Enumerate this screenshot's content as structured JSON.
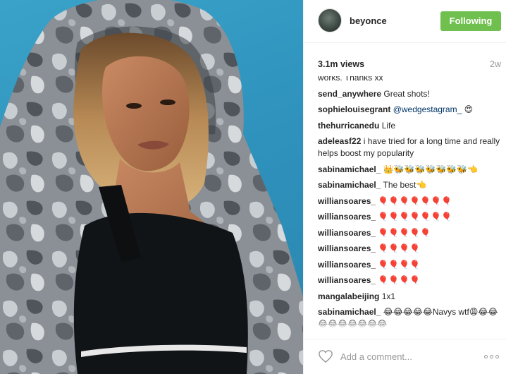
{
  "header": {
    "username": "beyonce",
    "follow_label": "Following"
  },
  "stats": {
    "views": "3.1m views",
    "age": "2w"
  },
  "comments": [
    {
      "user": "",
      "text": "works. Thanks xx"
    },
    {
      "user": "send_anywhere",
      "text": "Great shots!"
    },
    {
      "user": "sophielouisegrant",
      "mention": "@wedgestagram_",
      "text": " 😍"
    },
    {
      "user": "thehurricanedu",
      "text": "Life"
    },
    {
      "user": "adeleasf22",
      "text": "i have tried for a long time and really helps boost my popularity"
    },
    {
      "user": "sabinamichael_",
      "text": "👑🐝🐝🐝🐝🐝🐝🐝👈"
    },
    {
      "user": "sabinamichael_",
      "text": "The best👈"
    },
    {
      "user": "williansoares_",
      "text": "🎈🎈🎈🎈🎈🎈🎈"
    },
    {
      "user": "williansoares_",
      "text": "🎈🎈🎈🎈🎈🎈🎈"
    },
    {
      "user": "williansoares_",
      "text": "🎈🎈🎈🎈🎈"
    },
    {
      "user": "williansoares_",
      "text": "🎈🎈🎈🎈"
    },
    {
      "user": "williansoares_",
      "text": "🎈🎈🎈🎈"
    },
    {
      "user": "williansoares_",
      "text": "🎈🎈🎈🎈"
    },
    {
      "user": "mangalabeijing",
      "text": "1x1"
    },
    {
      "user": "sabinamichael_",
      "text": "😂😂😂😂😂Navys wtf😩😂😂😂😂😂😂😂😂😂"
    }
  ],
  "footer": {
    "comment_placeholder": "Add a comment...",
    "like_icon": "heart-icon",
    "more_icon": "more-options-icon"
  },
  "colors": {
    "follow_button": "#70c050",
    "mention": "#003569",
    "photo_background": "#2f93bd"
  }
}
